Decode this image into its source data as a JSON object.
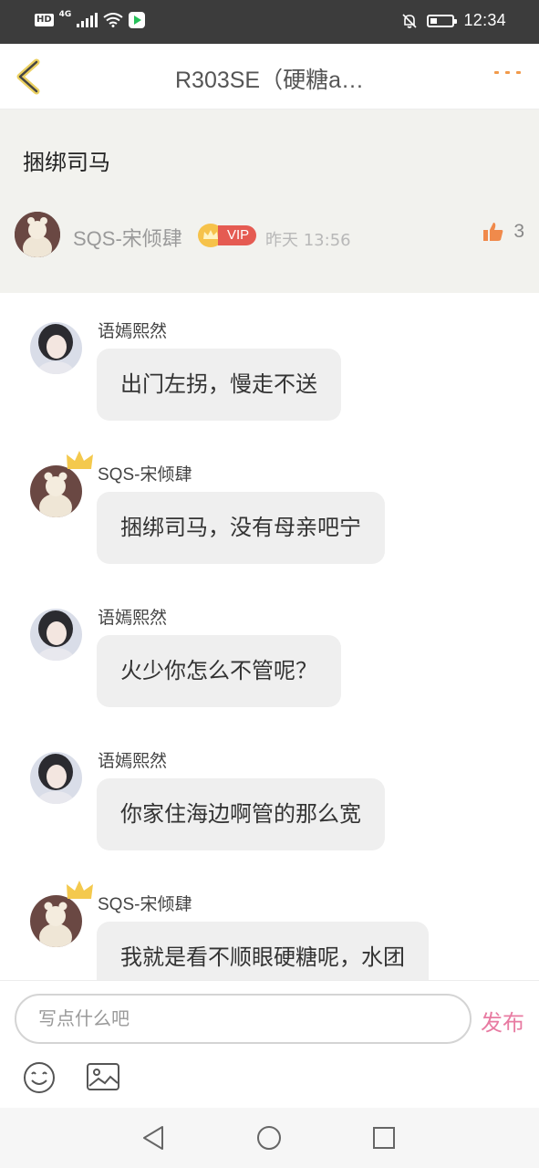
{
  "status_bar": {
    "time": "12:34",
    "network": "4G",
    "hd": "HD",
    "battery_level": 0.3,
    "icons": [
      "hd-icon",
      "signal-icon",
      "wifi-icon",
      "app-icon",
      "bell-muted-icon",
      "battery-icon"
    ]
  },
  "header": {
    "title": "R303SE（硬糖a…",
    "back_icon": "chevron-left-icon",
    "more_icon": "more-dots-icon",
    "accent_color": "#f19a4a"
  },
  "post": {
    "text": "捆绑司马",
    "author": "SQS-宋倾肆",
    "vip_label": "VIP",
    "time": "昨天 13:56",
    "like_count": "3",
    "like_icon": "thumbs-up-icon"
  },
  "comments": [
    {
      "name": "语嫣熙然",
      "text": "出门左拐，慢走不送",
      "crowned": false
    },
    {
      "name": "SQS-宋倾肆",
      "text": "捆绑司马，没有母亲吧宁",
      "crowned": true
    },
    {
      "name": "语嫣熙然",
      "text": "火少你怎么不管呢？",
      "crowned": false
    },
    {
      "name": "语嫣熙然",
      "text": "你家住海边啊管的那么宽",
      "crowned": false
    },
    {
      "name": "SQS-宋倾肆",
      "text": "我就是看不顺眼硬糖呢，水团",
      "crowned": true
    }
  ],
  "input": {
    "placeholder": "写点什么吧",
    "publish_label": "发布",
    "publish_color": "#e87ba2",
    "emoji_icon": "smiley-icon",
    "image_icon": "image-icon"
  },
  "nav": {
    "icons": [
      "nav-back-icon",
      "nav-home-icon",
      "nav-recent-icon"
    ]
  }
}
